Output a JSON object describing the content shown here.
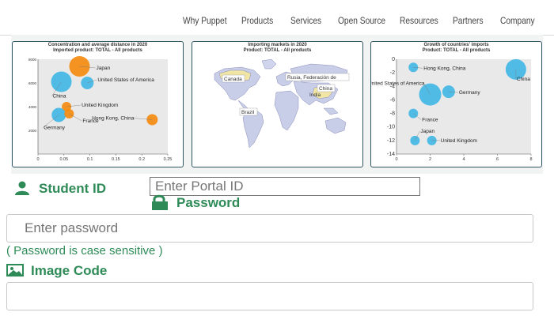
{
  "nav": {
    "items": [
      "Why Puppet",
      "Products",
      "Services",
      "Open Source",
      "Resources",
      "Partners",
      "Company"
    ]
  },
  "colors": {
    "green": "#2e8b57",
    "orange": "#f5890b",
    "cyan": "#3fb7e6",
    "card_border": "#2e5560"
  },
  "cards": {
    "scatter": {
      "title": "Concentration and average distance in 2020",
      "subtitle": "Imported product: TOTAL - All products"
    },
    "map": {
      "title": "Importing markets in 2020",
      "subtitle": "Product: TOTAL - All products",
      "labels": [
        "Canada",
        "Rusia, Federación de",
        "China",
        "India",
        "Brazil"
      ]
    },
    "growth": {
      "title": "Growth of countries' imports",
      "subtitle": "Product: TOTAL - All products"
    }
  },
  "chart_data": [
    {
      "type": "scatter",
      "title": "Concentration and average distance in 2020",
      "subtitle": "Imported product: TOTAL - All products",
      "xlim": [
        0,
        0.25
      ],
      "ylim": [
        0,
        8000
      ],
      "x_ticks": [
        "0",
        "0.05",
        "0.1",
        "0.15",
        "0.2",
        "0.25"
      ],
      "y_ticks": [
        "8000",
        "6000",
        "4000",
        "2000"
      ],
      "points": [
        {
          "label": "Japan",
          "x": 0.08,
          "y": 7400,
          "color": "orange",
          "size": 13
        },
        {
          "label": "United States of America",
          "x": 0.095,
          "y": 6000,
          "color": "cyan",
          "size": 8
        },
        {
          "label": "China",
          "x": 0.045,
          "y": 6100,
          "color": "cyan",
          "size": 13
        },
        {
          "label": "United Kingdom",
          "x": 0.055,
          "y": 4000,
          "color": "orange",
          "size": 6
        },
        {
          "label": "Germany",
          "x": 0.04,
          "y": 3300,
          "color": "cyan",
          "size": 9
        },
        {
          "label": "France",
          "x": 0.06,
          "y": 3400,
          "color": "orange",
          "size": 6
        },
        {
          "label": "Hong Kong, China",
          "x": 0.22,
          "y": 2900,
          "color": "orange",
          "size": 7
        }
      ]
    },
    {
      "type": "scatter",
      "title": "Growth of countries' imports",
      "subtitle": "Product: TOTAL - All products",
      "xlim": [
        0,
        8
      ],
      "ylim": [
        -14,
        0
      ],
      "x_ticks": [
        "0",
        "2",
        "4",
        "6",
        "8"
      ],
      "y_ticks": [
        "0",
        "-2",
        "-4",
        "-6",
        "-8",
        "-10",
        "-12",
        "-14"
      ],
      "points": [
        {
          "label": "Hong Kong, China",
          "x": 1,
          "y": -1.2,
          "color": "cyan",
          "size": 6
        },
        {
          "label": "China",
          "x": 7.1,
          "y": -1.5,
          "color": "cyan",
          "size": 13
        },
        {
          "label": "United States of America",
          "x": 2,
          "y": -5.2,
          "color": "cyan",
          "size": 14
        },
        {
          "label": "Germany",
          "x": 3.1,
          "y": -4.8,
          "color": "cyan",
          "size": 8
        },
        {
          "label": "France",
          "x": 1,
          "y": -8,
          "color": "cyan",
          "size": 6
        },
        {
          "label": "Japan",
          "x": 1.1,
          "y": -12,
          "color": "cyan",
          "size": 6
        },
        {
          "label": "United Kingdom",
          "x": 2.1,
          "y": -12,
          "color": "cyan",
          "size": 6
        }
      ]
    }
  ],
  "form": {
    "student_label": "Student ID",
    "portal_placeholder": "Enter Portal ID",
    "password_label": "Password",
    "password_placeholder": "Enter password",
    "hint": "( Password is case sensitive )",
    "image_code_label": "Image Code"
  }
}
